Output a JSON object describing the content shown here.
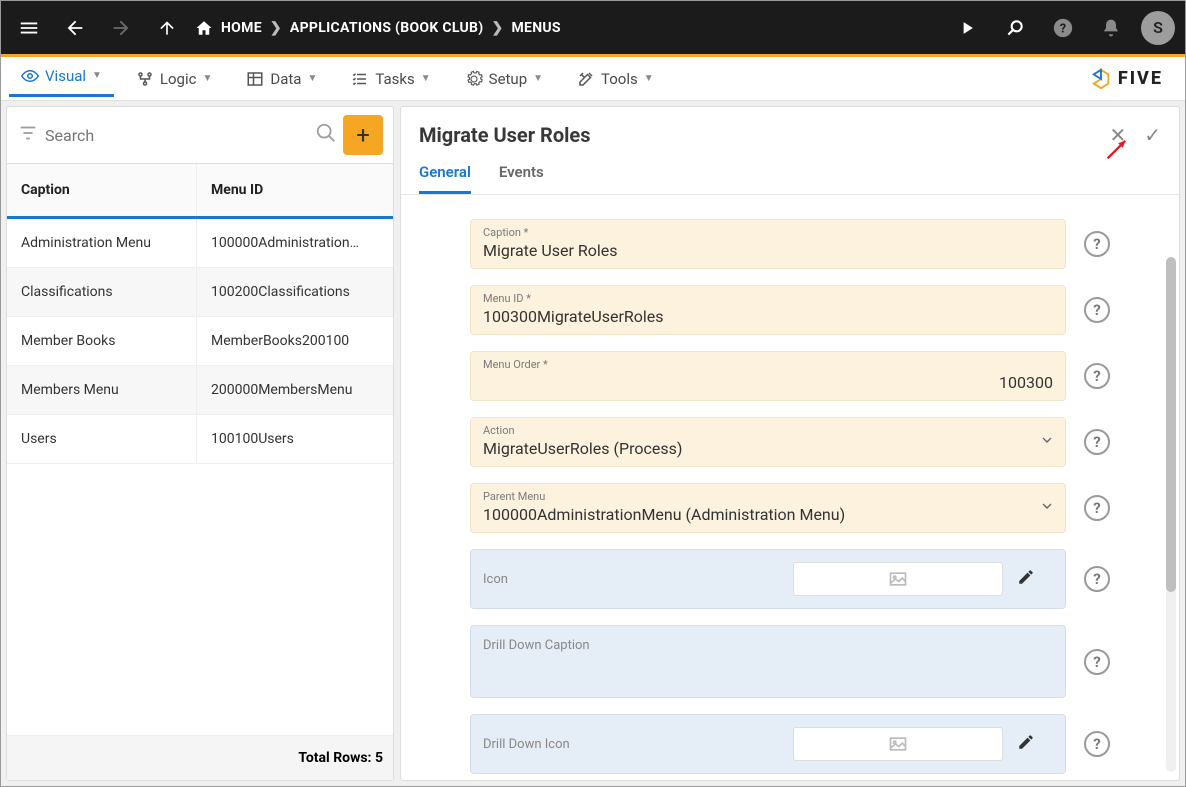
{
  "topbar": {
    "home": "HOME",
    "applications": "APPLICATIONS (BOOK CLUB)",
    "menus": "MENUS",
    "avatar_initial": "S"
  },
  "menubar": {
    "visual": "Visual",
    "logic": "Logic",
    "data": "Data",
    "tasks": "Tasks",
    "setup": "Setup",
    "tools": "Tools",
    "logo": "FIVE"
  },
  "left": {
    "search_placeholder": "Search",
    "col_caption": "Caption",
    "col_menuid": "Menu ID",
    "rows": [
      {
        "caption": "Administration Menu",
        "menuid": "100000Administration…"
      },
      {
        "caption": "Classifications",
        "menuid": "100200Classifications"
      },
      {
        "caption": "Member Books",
        "menuid": "MemberBooks200100"
      },
      {
        "caption": "Members Menu",
        "menuid": "200000MembersMenu"
      },
      {
        "caption": "Users",
        "menuid": "100100Users"
      }
    ],
    "footer": "Total Rows: 5"
  },
  "right": {
    "title": "Migrate User Roles",
    "tab_general": "General",
    "tab_events": "Events",
    "fields": {
      "caption_label": "Caption *",
      "caption_value": "Migrate User Roles",
      "menuid_label": "Menu ID *",
      "menuid_value": "100300MigrateUserRoles",
      "menuorder_label": "Menu Order *",
      "menuorder_value": "100300",
      "action_label": "Action",
      "action_value": "MigrateUserRoles (Process)",
      "parent_label": "Parent Menu",
      "parent_value": "100000AdministrationMenu (Administration Menu)",
      "icon_label": "Icon",
      "ddcaption_label": "Drill Down Caption",
      "ddicon_label": "Drill Down Icon"
    }
  }
}
